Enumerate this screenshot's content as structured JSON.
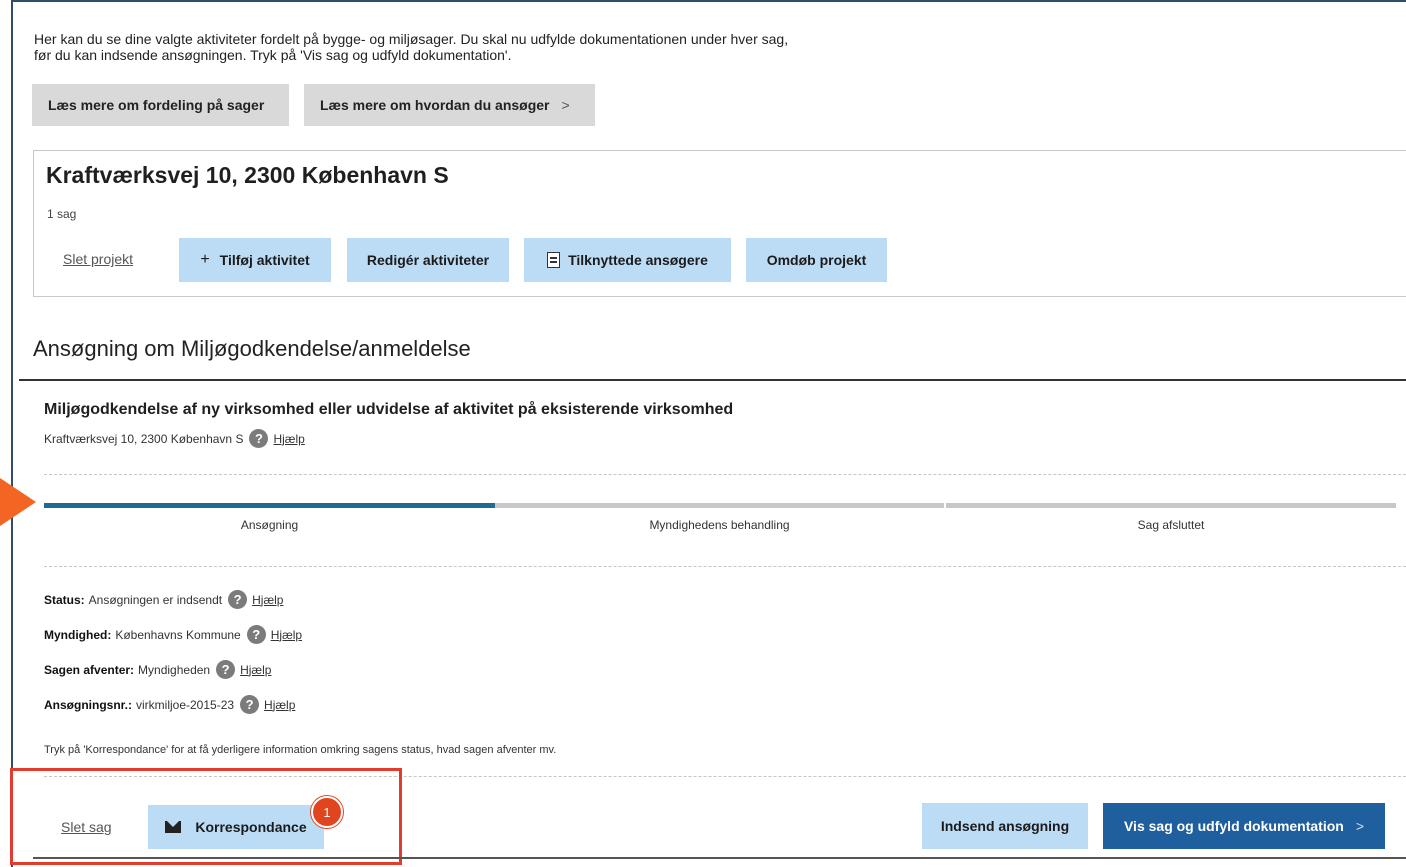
{
  "intro": {
    "line1": "Her kan du se dine valgte aktiviteter fordelt på bygge- og miljøsager. Du skal nu udfylde dokumentationen under hver sag,",
    "line2": "før du kan indsende ansøgningen. Tryk på 'Vis sag og udfyld dokumentation'."
  },
  "top_buttons": {
    "read_distribution": "Læs mere om fordeling på sager",
    "read_how_apply": "Læs mere om hvordan du ansøger",
    "chevron": ">"
  },
  "project": {
    "title": "Kraftværksvej 10, 2300 København S",
    "count": "1 sag",
    "delete_link": "Slet projekt",
    "add_activity": "Tilføj aktivitet",
    "add_icon": "+",
    "edit_activities": "Redigér aktiviteter",
    "applicants": "Tilknyttede ansøgere",
    "rename": "Omdøb projekt"
  },
  "section": {
    "title": "Ansøgning om Miljøgodkendelse/anmeldelse"
  },
  "case": {
    "title": "Miljøgodkendelse af ny virksomhed eller udvidelse af aktivitet på eksisterende virksomhed",
    "address": "Kraftværksvej 10, 2300 København S",
    "help_label": "Hjælp",
    "help_icon": "?"
  },
  "progress": {
    "steps": [
      "Ansøgning",
      "Myndighedens behandling",
      "Sag afsluttet"
    ],
    "current_step": 1,
    "active_color": "#1d6b93",
    "inactive_color": "#c8c8c8"
  },
  "details": {
    "status_label": "Status:",
    "status_value": "Ansøgningen er indsendt",
    "authority_label": "Myndighed:",
    "authority_value": "Københavns Kommune",
    "awaiting_label": "Sagen afventer:",
    "awaiting_value": "Myndigheden",
    "appno_label": "Ansøgningsnr.:",
    "appno_value": "virkmiljoe-2015-23",
    "note": "Tryk på 'Korrespondance' for at få yderligere information omkring sagens status, hvad sagen afventer mv."
  },
  "actions": {
    "delete_case": "Slet sag",
    "correspondence": "Korrespondance",
    "submit": "Indsend ansøgning",
    "view_case": "Vis sag og udfyld dokumentation",
    "badge": "1"
  },
  "colors": {
    "light_button": "#bcdcf6",
    "primary_button": "#1f5f9d",
    "highlight": "#e33b2f",
    "arrow": "#f26522"
  }
}
